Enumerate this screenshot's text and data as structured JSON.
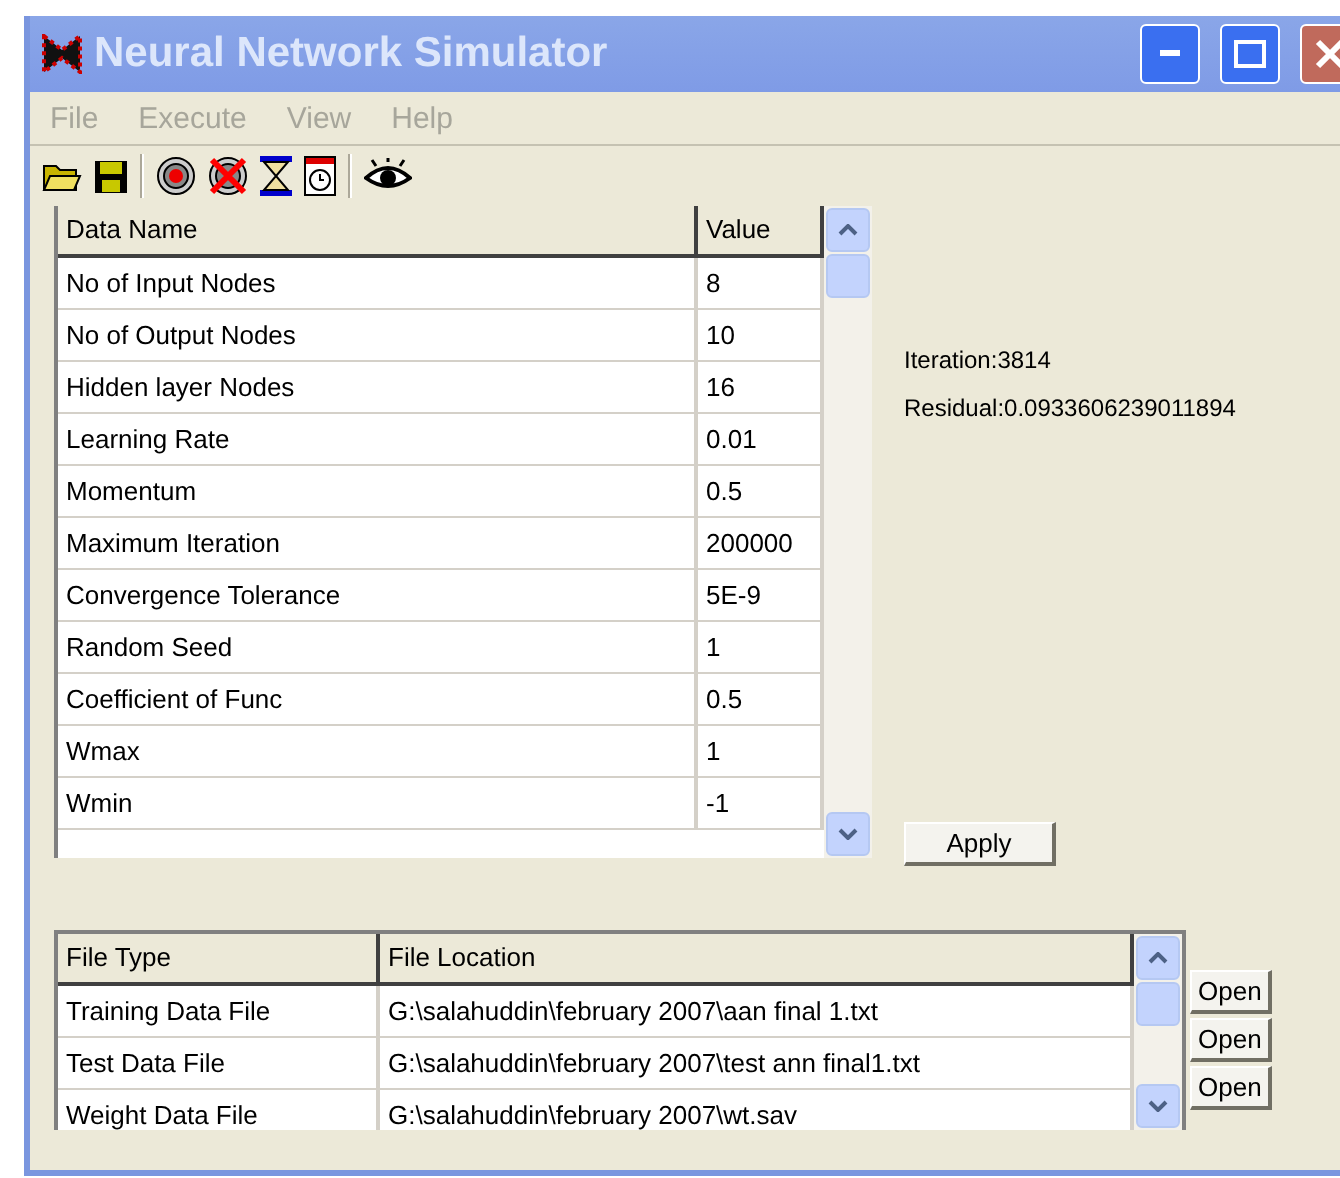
{
  "window": {
    "title": "Neural Network Simulator"
  },
  "menu": [
    {
      "label": "File",
      "disabled": true
    },
    {
      "label": "Execute",
      "disabled": true
    },
    {
      "label": "View",
      "disabled": true
    },
    {
      "label": "Help",
      "disabled": true
    }
  ],
  "toolbar": [
    {
      "kind": "open"
    },
    {
      "kind": "save"
    },
    {
      "kind": "sep"
    },
    {
      "kind": "run"
    },
    {
      "kind": "stop"
    },
    {
      "kind": "hourglass"
    },
    {
      "kind": "timer"
    },
    {
      "kind": "sep"
    },
    {
      "kind": "eye"
    }
  ],
  "parameters": {
    "columns": [
      "Data Name",
      "Value"
    ],
    "rows": [
      [
        "No of Input Nodes",
        "8"
      ],
      [
        "No of Output Nodes",
        "10"
      ],
      [
        "Hidden layer Nodes",
        "16"
      ],
      [
        "Learning Rate",
        "0.01"
      ],
      [
        "Momentum",
        "0.5"
      ],
      [
        "Maximum Iteration",
        "200000"
      ],
      [
        "Convergence Tolerance",
        "5E-9"
      ],
      [
        "Random Seed",
        "1"
      ],
      [
        "Coefficient of Func",
        "0.5"
      ],
      [
        "Wmax",
        "1"
      ],
      [
        "Wmin",
        "-1"
      ]
    ]
  },
  "status": {
    "iteration": "Iteration:3814",
    "residual": "Residual:0.0933606239011894"
  },
  "apply_button": "Apply",
  "files": {
    "columns": [
      "File Type",
      "File Location"
    ],
    "rows": [
      [
        "Training Data File",
        "G:\\salahuddin\\february 2007\\aan final 1.txt"
      ],
      [
        "Test Data File",
        "G:\\salahuddin\\february 2007\\test ann final1.txt"
      ],
      [
        "Weight Data File",
        "G:\\salahuddin\\february 2007\\wt.sav"
      ]
    ],
    "open_buttons": [
      "Open",
      "Open",
      "Open"
    ]
  }
}
